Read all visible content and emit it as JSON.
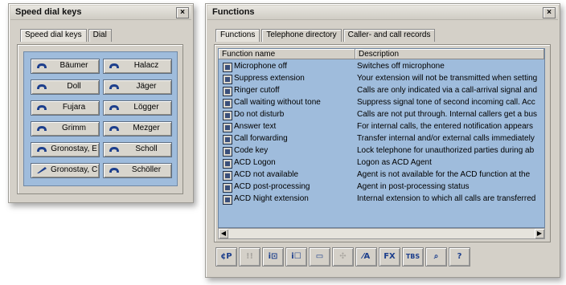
{
  "speed_dial": {
    "title": "Speed dial keys",
    "close": "×",
    "tabs": [
      {
        "label": "Speed dial keys"
      },
      {
        "label": "Dial"
      }
    ],
    "keys": [
      {
        "label": "Bäumer"
      },
      {
        "label": "Halacz"
      },
      {
        "label": "Doll"
      },
      {
        "label": "Jäger"
      },
      {
        "label": "Fujara"
      },
      {
        "label": "Lögger"
      },
      {
        "label": "Grimm"
      },
      {
        "label": "Mezger"
      },
      {
        "label": "Gronostay, E"
      },
      {
        "label": "Scholl"
      },
      {
        "label": "Gronostay, C"
      },
      {
        "label": "Schöller"
      }
    ]
  },
  "functions": {
    "title": "Functions",
    "close": "×",
    "tabs": [
      {
        "label": "Functions"
      },
      {
        "label": "Telephone directory"
      },
      {
        "label": "Caller- and call records"
      }
    ],
    "columns": {
      "name": "Function name",
      "description": "Description"
    },
    "rows": [
      {
        "name": "Microphone off",
        "desc": "Switches off microphone"
      },
      {
        "name": "Suppress extension",
        "desc": "Your extension will not be transmitted when setting"
      },
      {
        "name": "Ringer cutoff",
        "desc": "Calls are only indicated via a call-arrival signal and"
      },
      {
        "name": "Call waiting without tone",
        "desc": "Suppress signal tone of second incoming call. Acc"
      },
      {
        "name": "Do not disturb",
        "desc": "Calls are not put through. Internal callers get a bus"
      },
      {
        "name": "Answer text",
        "desc": "For internal calls, the entered notification appears"
      },
      {
        "name": "Call forwarding",
        "desc": "Transfer internal and/or external calls immediately"
      },
      {
        "name": "Code key",
        "desc": "Lock telephone for unauthorized parties during ab"
      },
      {
        "name": "ACD Logon",
        "desc": "Logon as ACD Agent"
      },
      {
        "name": "ACD not available",
        "desc": "Agent is not available for the ACD function at the"
      },
      {
        "name": "ACD post-processing",
        "desc": "Agent in post-processing status"
      },
      {
        "name": "ACD Night extension",
        "desc": "Internal extension to which all calls are transferred"
      }
    ],
    "toolbar": [
      {
        "icon": "call-phone-icon",
        "text": "¢P"
      },
      {
        "icon": "disabled-icon",
        "text": "!!"
      },
      {
        "icon": "info-direct-icon",
        "text": "i⊡"
      },
      {
        "icon": "info-call-icon",
        "text": "i☐"
      },
      {
        "icon": "display-icon",
        "text": "▭"
      },
      {
        "icon": "move-icon",
        "text": "✣"
      },
      {
        "icon": "edit-icon",
        "text": "⁄A"
      },
      {
        "icon": "fax-icon",
        "text": "FX"
      },
      {
        "icon": "tbs-icon",
        "text": "TBS"
      },
      {
        "icon": "search-icon",
        "text": "⌕"
      },
      {
        "icon": "help-icon",
        "text": "?"
      }
    ]
  }
}
